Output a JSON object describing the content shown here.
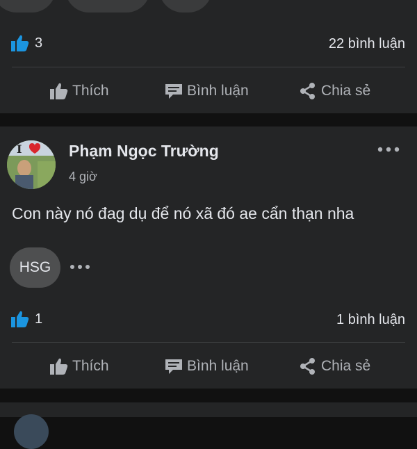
{
  "post1": {
    "like_count": "3",
    "comment_count": "22 bình luận"
  },
  "post2": {
    "author": "Phạm Ngọc Trường",
    "time": "4 giờ",
    "text": "Con này nó đag dụ để nó xã đó ae cẩn thạn nha",
    "group_badge": "HSG",
    "like_count": "1",
    "comment_count": "1 bình luận"
  },
  "actions": {
    "like": "Thích",
    "comment": "Bình luận",
    "share": "Chia sẻ"
  },
  "colors": {
    "background": "#111111",
    "card": "#242526",
    "like_blue": "#1b95e0",
    "text": "#e4e6eb",
    "muted": "#b0b3b8"
  },
  "icons": [
    "thumbs-up-icon",
    "comment-icon",
    "share-icon",
    "more-icon",
    "heart-icon"
  ]
}
